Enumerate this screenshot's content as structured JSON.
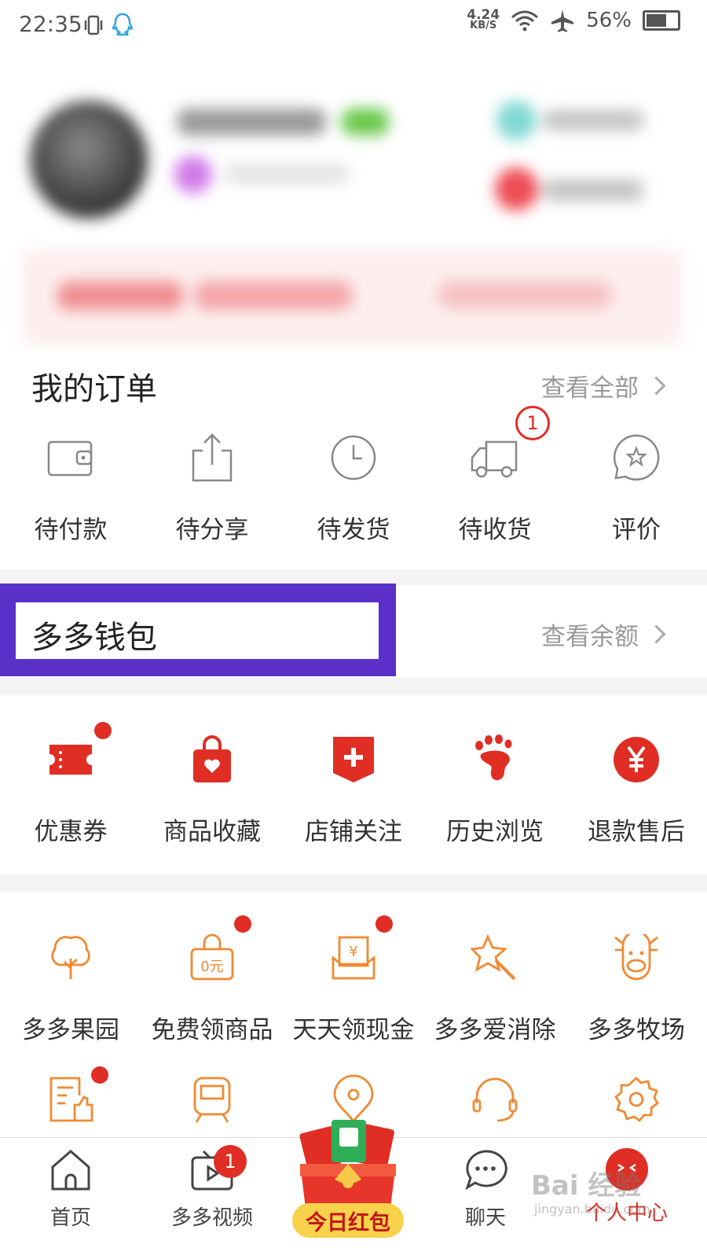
{
  "status_bar": {
    "time": "22:35",
    "speed_value": "4.24",
    "speed_unit": "KB/S",
    "battery": "56%"
  },
  "orders": {
    "title": "我的订单",
    "view_all": "查看全部",
    "items": [
      {
        "label": "待付款",
        "icon": "wallet-icon"
      },
      {
        "label": "待分享",
        "icon": "share-icon"
      },
      {
        "label": "待发货",
        "icon": "clock-icon"
      },
      {
        "label": "待收货",
        "icon": "truck-icon",
        "badge": "1"
      },
      {
        "label": "评价",
        "icon": "star-bubble-icon"
      }
    ]
  },
  "wallet": {
    "title": "多多钱包",
    "view_balance": "查看余额"
  },
  "shortcuts": {
    "items": [
      {
        "label": "优惠券",
        "icon": "ticket-icon",
        "dot": true
      },
      {
        "label": "商品收藏",
        "icon": "heart-bag-icon"
      },
      {
        "label": "店铺关注",
        "icon": "store-plus-icon"
      },
      {
        "label": "历史浏览",
        "icon": "footprint-icon"
      },
      {
        "label": "退款售后",
        "icon": "yuan-circle-icon"
      }
    ]
  },
  "services": {
    "row1": [
      {
        "label": "多多果园",
        "icon": "tree-icon"
      },
      {
        "label": "免费领商品",
        "icon": "zero-bag-icon",
        "dot": true
      },
      {
        "label": "天天领现金",
        "icon": "cash-envelope-icon",
        "dot": true
      },
      {
        "label": "多多爱消除",
        "icon": "star-wand-icon"
      },
      {
        "label": "多多牧场",
        "icon": "cow-icon"
      }
    ],
    "row2": [
      {
        "icon": "note-thumb-icon",
        "dot": true
      },
      {
        "icon": "train-icon"
      },
      {
        "icon": "location-icon"
      },
      {
        "icon": "headset-icon"
      },
      {
        "icon": "settings-icon"
      }
    ]
  },
  "bottom_nav": {
    "home": "首页",
    "video": "多多视频",
    "video_badge": "1",
    "red_packet": "今日红包",
    "chat": "聊天",
    "profile": "个人中心"
  },
  "watermark": {
    "brand": "Bai 经验",
    "url": "jingyan.baidu.com"
  },
  "colors": {
    "accent": "#e02e24",
    "orange": "#f08a33",
    "highlight": "#5a30c8"
  }
}
